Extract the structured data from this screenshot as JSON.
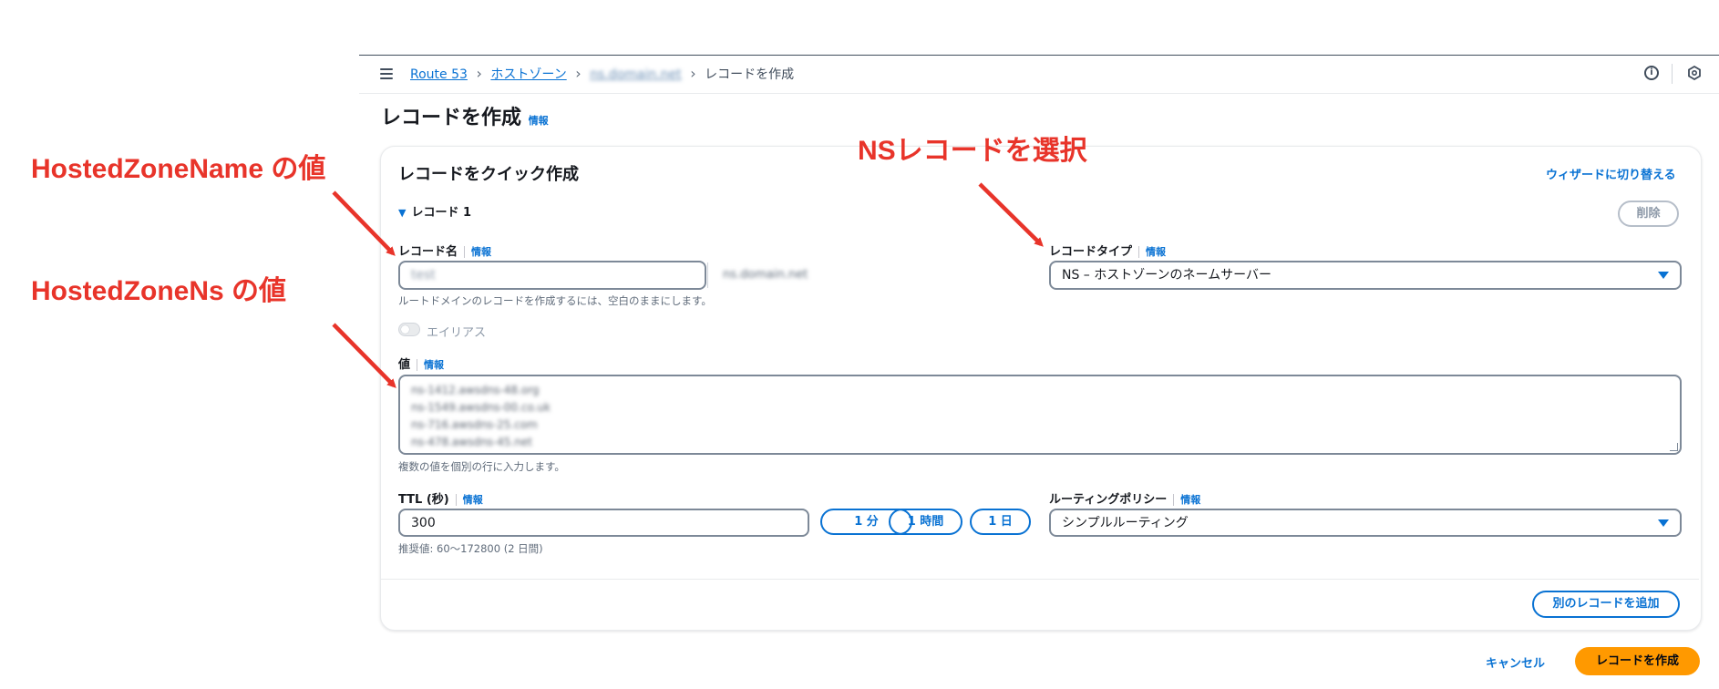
{
  "breadcrumb": {
    "items": [
      "Route 53",
      "ホストゾーン",
      "ns.domain.net"
    ],
    "current": "レコードを作成"
  },
  "page": {
    "title": "レコードを作成",
    "info_label": "情報"
  },
  "panel": {
    "title": "レコードをクイック作成",
    "wizard_link": "ウィザードに切り替える",
    "record_section": "レコード 1",
    "delete_label": "削除"
  },
  "record_name": {
    "label": "レコード名",
    "info": "情報",
    "value": "test",
    "domain_suffix": "ns.domain.net",
    "hint": "ルートドメインのレコードを作成するには、空白のままにします。"
  },
  "record_type": {
    "label": "レコードタイプ",
    "info": "情報",
    "value": "NS – ホストゾーンのネームサーバー"
  },
  "alias": {
    "label": "エイリアス",
    "enabled": false
  },
  "value_field": {
    "label": "値",
    "info": "情報",
    "lines": [
      "ns-1412.awsdns-48.org",
      "ns-1549.awsdns-00.co.uk",
      "ns-716.awsdns-25.com",
      "ns-478.awsdns-45.net"
    ],
    "hint": "複数の値を個別の行に入力します。"
  },
  "ttl": {
    "label": "TTL (秒)",
    "info": "情報",
    "value": "300",
    "hint": "推奨値: 60～172800 (2 日間)",
    "presets": [
      "1 分",
      "1 時間",
      "1 日"
    ]
  },
  "routing_policy": {
    "label": "ルーティングポリシー",
    "info": "情報",
    "value": "シンプルルーティング"
  },
  "actions": {
    "add_record": "別のレコードを追加",
    "cancel": "キャンセル",
    "create": "レコードを作成"
  },
  "annotations": {
    "hosted_zone_name": "HostedZoneName の値",
    "hosted_zone_ns": "HostedZoneNs の値",
    "select_ns": "NSレコードを選択"
  },
  "colors": {
    "accent": "#0972d3",
    "primary_button": "#ff9900",
    "annotation": "#e8342a"
  }
}
